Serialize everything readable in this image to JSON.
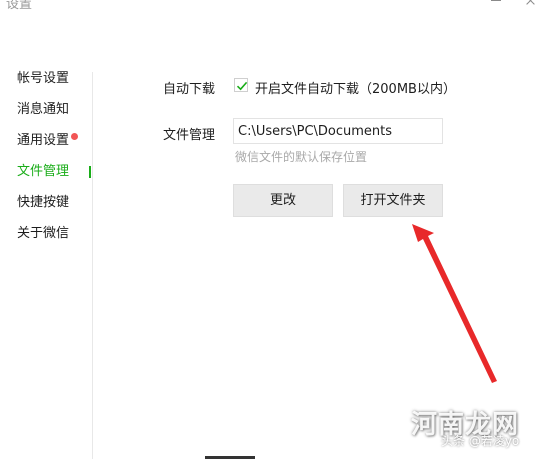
{
  "window": {
    "title": "设置"
  },
  "sidebar": {
    "items": [
      {
        "label": "帐号设置"
      },
      {
        "label": "消息通知"
      },
      {
        "label": "通用设置"
      },
      {
        "label": "文件管理"
      },
      {
        "label": "快捷按键"
      },
      {
        "label": "关于微信"
      }
    ],
    "active_index": 3,
    "badge_item_index": 2
  },
  "auto_download": {
    "label": "自动下载",
    "checkbox_label": "开启文件自动下载（200MB以内）",
    "checked": true
  },
  "file_management": {
    "label": "文件管理",
    "path_value": "C:\\Users\\PC\\Documents",
    "hint": "微信文件的默认保存位置"
  },
  "buttons": {
    "change_label": "更改",
    "open_folder_label": "打开文件夹"
  },
  "watermark": {
    "main": "河南龙网",
    "sub": "头条 @若凌yo"
  },
  "colors": {
    "accent_green": "#1aad19",
    "badge_red": "#f25555",
    "arrow_red": "#e8292a"
  }
}
